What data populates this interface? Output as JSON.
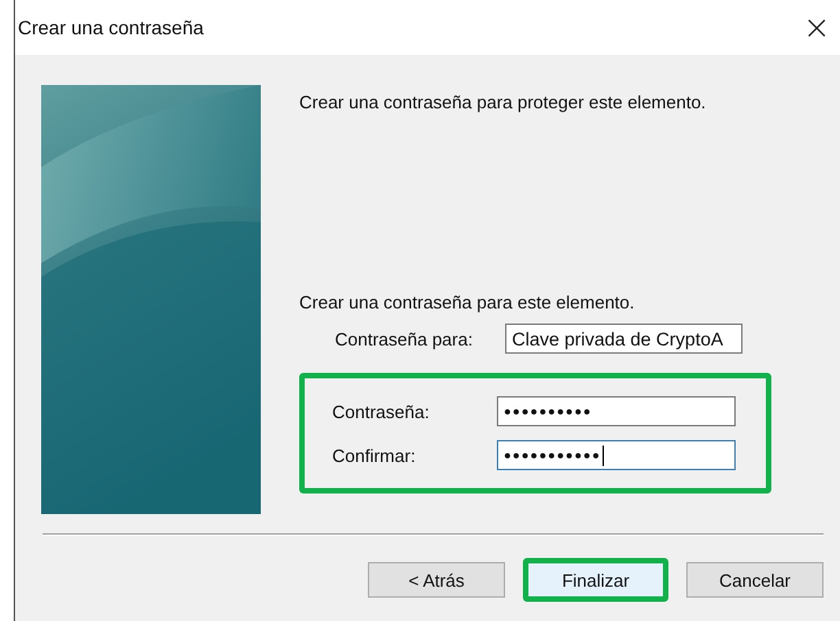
{
  "window": {
    "title": "Crear una contraseña",
    "close": "×"
  },
  "intro": "Crear una contraseña para proteger este elemento.",
  "section_label": "Crear una contraseña para este elemento.",
  "password_for": {
    "label": "Contraseña para:",
    "value": "Clave privada de CryptoA"
  },
  "password_group": {
    "highlighted": true,
    "fields": [
      {
        "label": "Contraseña:",
        "value": "●●●●●●●●●●",
        "focused": false
      },
      {
        "label": "Confirmar:",
        "value": "●●●●●●●●●●●",
        "focused": true
      }
    ]
  },
  "buttons": [
    {
      "label": "< Atrás",
      "highlighted": false
    },
    {
      "label": "Finalizar",
      "highlighted": true
    },
    {
      "label": "Cancelar",
      "highlighted": false
    }
  ]
}
